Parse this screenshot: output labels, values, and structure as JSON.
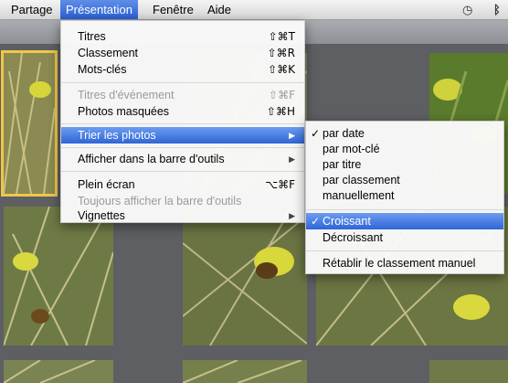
{
  "menubar": {
    "items": [
      "Partage",
      "Présentation",
      "Fenêtre",
      "Aide"
    ],
    "active": "Présentation",
    "right_icons": [
      "time-machine-icon",
      "bluetooth-icon"
    ]
  },
  "presentation_menu": {
    "items": [
      {
        "label": "Titres",
        "shortcut": "⇧⌘T",
        "enabled": true
      },
      {
        "label": "Classement",
        "shortcut": "⇧⌘R",
        "enabled": true
      },
      {
        "label": "Mots-clés",
        "shortcut": "⇧⌘K",
        "enabled": true
      },
      {
        "label": "Titres d'événement",
        "shortcut": "⇧⌘F",
        "enabled": false
      },
      {
        "label": "Photos masquées",
        "shortcut": "⇧⌘H",
        "enabled": true
      },
      {
        "label": "Trier les photos",
        "submenu": true,
        "highlighted": true
      },
      {
        "label": "Afficher dans la barre d'outils",
        "submenu": true
      },
      {
        "label": "Plein écran",
        "shortcut": "⌥⌘F",
        "enabled": true
      },
      {
        "label": "Toujours afficher la barre d'outils",
        "enabled": false
      },
      {
        "label": "Vignettes",
        "submenu": true
      }
    ]
  },
  "sort_submenu": {
    "items": [
      {
        "label": "par date",
        "checked": true
      },
      {
        "label": "par mot-clé",
        "checked": false
      },
      {
        "label": "par titre",
        "checked": false
      },
      {
        "label": "par classement",
        "checked": false
      },
      {
        "label": "manuellement",
        "checked": false
      },
      {
        "label": "Croissant",
        "checked": true,
        "highlighted": true
      },
      {
        "label": "Décroissant",
        "checked": false
      },
      {
        "label": "Rétablir le classement manuel",
        "checked": false
      }
    ]
  },
  "symbols": {
    "check": "✓",
    "submenu_arrow": "▶",
    "time_machine": "◷",
    "bluetooth": "ᛒ"
  },
  "colors": {
    "highlight": "#3a6fdc",
    "selection_outline": "#f0c64a",
    "background": "#5d5f62"
  }
}
